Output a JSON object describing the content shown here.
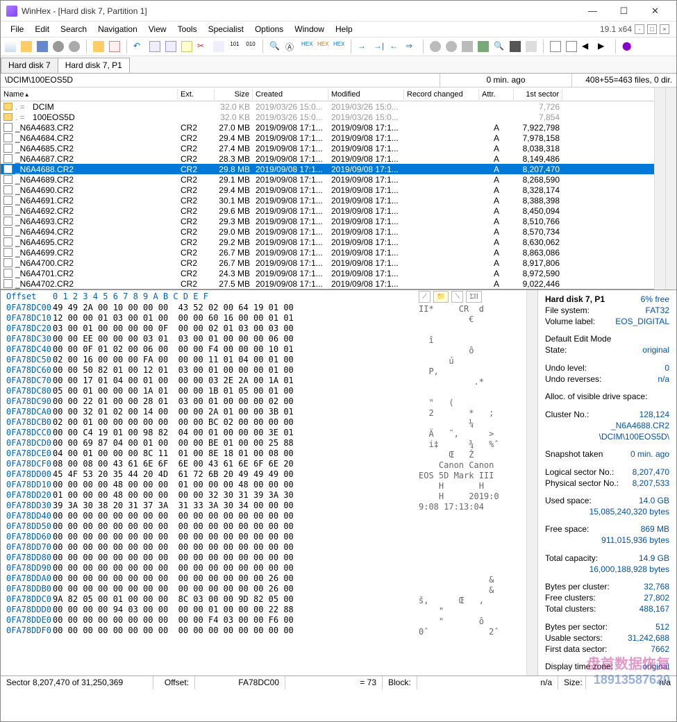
{
  "window": {
    "title": "WinHex - [Hard disk 7, Partition 1]",
    "version": "19.1 x64"
  },
  "menu": [
    "File",
    "Edit",
    "Search",
    "Navigation",
    "View",
    "Tools",
    "Specialist",
    "Options",
    "Window",
    "Help"
  ],
  "tabs": [
    {
      "label": "Hard disk 7",
      "active": false
    },
    {
      "label": "Hard disk 7, P1",
      "active": true
    }
  ],
  "pathbar": {
    "path": "\\DCIM\\100EOS5D",
    "age": "0 min. ago",
    "summary": "408+55=463 files, 0 dir."
  },
  "columns": [
    "Name",
    "Ext.",
    "Size",
    "Created",
    "Modified",
    "Record changed",
    "Attr.",
    "1st sector"
  ],
  "folders": [
    {
      "name": "DCIM",
      "prefix": ". =",
      "size": "32.0 KB",
      "created": "2019/03/26 15:0...",
      "modified": "2019/03/26 15:0...",
      "sector": "7,726"
    },
    {
      "name": "100EOS5D",
      "prefix": ". =",
      "size": "32.0 KB",
      "created": "2019/03/26 15:0...",
      "modified": "2019/03/26 15:0...",
      "sector": "7,854"
    }
  ],
  "files": [
    {
      "name": "_N6A4683.CR2",
      "ext": "CR2",
      "size": "27.0 MB",
      "created": "2019/09/08 17:1...",
      "modified": "2019/09/08 17:1...",
      "attr": "A",
      "sector": "7,922,798",
      "sel": false
    },
    {
      "name": "_N6A4684.CR2",
      "ext": "CR2",
      "size": "29.4 MB",
      "created": "2019/09/08 17:1...",
      "modified": "2019/09/08 17:1...",
      "attr": "A",
      "sector": "7,978,158",
      "sel": false
    },
    {
      "name": "_N6A4685.CR2",
      "ext": "CR2",
      "size": "27.4 MB",
      "created": "2019/09/08 17:1...",
      "modified": "2019/09/08 17:1...",
      "attr": "A",
      "sector": "8,038,318",
      "sel": false
    },
    {
      "name": "_N6A4687.CR2",
      "ext": "CR2",
      "size": "28.3 MB",
      "created": "2019/09/08 17:1...",
      "modified": "2019/09/08 17:1...",
      "attr": "A",
      "sector": "8,149,486",
      "sel": false
    },
    {
      "name": "_N6A4688.CR2",
      "ext": "CR2",
      "size": "29.8 MB",
      "created": "2019/09/08 17:1...",
      "modified": "2019/09/08 17:1...",
      "attr": "A",
      "sector": "8,207,470",
      "sel": true
    },
    {
      "name": "_N6A4689.CR2",
      "ext": "CR2",
      "size": "29.1 MB",
      "created": "2019/09/08 17:1...",
      "modified": "2019/09/08 17:1...",
      "attr": "A",
      "sector": "8,268,590",
      "sel": false
    },
    {
      "name": "_N6A4690.CR2",
      "ext": "CR2",
      "size": "29.4 MB",
      "created": "2019/09/08 17:1...",
      "modified": "2019/09/08 17:1...",
      "attr": "A",
      "sector": "8,328,174",
      "sel": false
    },
    {
      "name": "_N6A4691.CR2",
      "ext": "CR2",
      "size": "30.1 MB",
      "created": "2019/09/08 17:1...",
      "modified": "2019/09/08 17:1...",
      "attr": "A",
      "sector": "8,388,398",
      "sel": false
    },
    {
      "name": "_N6A4692.CR2",
      "ext": "CR2",
      "size": "29.6 MB",
      "created": "2019/09/08 17:1...",
      "modified": "2019/09/08 17:1...",
      "attr": "A",
      "sector": "8,450,094",
      "sel": false
    },
    {
      "name": "_N6A4693.CR2",
      "ext": "CR2",
      "size": "29.3 MB",
      "created": "2019/09/08 17:1...",
      "modified": "2019/09/08 17:1...",
      "attr": "A",
      "sector": "8,510,766",
      "sel": false
    },
    {
      "name": "_N6A4694.CR2",
      "ext": "CR2",
      "size": "29.0 MB",
      "created": "2019/09/08 17:1...",
      "modified": "2019/09/08 17:1...",
      "attr": "A",
      "sector": "8,570,734",
      "sel": false
    },
    {
      "name": "_N6A4695.CR2",
      "ext": "CR2",
      "size": "29.2 MB",
      "created": "2019/09/08 17:1...",
      "modified": "2019/09/08 17:1...",
      "attr": "A",
      "sector": "8,630,062",
      "sel": false
    },
    {
      "name": "_N6A4699.CR2",
      "ext": "CR2",
      "size": "26.7 MB",
      "created": "2019/09/08 17:1...",
      "modified": "2019/09/08 17:1...",
      "attr": "A",
      "sector": "8,863,086",
      "sel": false
    },
    {
      "name": "_N6A4700.CR2",
      "ext": "CR2",
      "size": "26.7 MB",
      "created": "2019/09/08 17:1...",
      "modified": "2019/09/08 17:1...",
      "attr": "A",
      "sector": "8,917,806",
      "sel": false
    },
    {
      "name": "_N6A4701.CR2",
      "ext": "CR2",
      "size": "24.3 MB",
      "created": "2019/09/08 17:1...",
      "modified": "2019/09/08 17:1...",
      "attr": "A",
      "sector": "8,972,590",
      "sel": false
    },
    {
      "name": "_N6A4702.CR2",
      "ext": "CR2",
      "size": "27.5 MB",
      "created": "2019/09/08 17:1...",
      "modified": "2019/09/08 17:1...",
      "attr": "A",
      "sector": "9,022,446",
      "sel": false
    }
  ],
  "hex": {
    "header": " 0  1  2  3  4  5  6  7   8  9  A  B  C  D  E  F",
    "header0": "Offset",
    "rows": [
      {
        "o": "0FA78DC00",
        "b": "49 49 2A 00 10 00 00 00  43 52 02 00 64 19 01 00",
        "a": "II*     CR  d   "
      },
      {
        "o": "0FA78DC10",
        "b": "12 00 00 01 03 00 01 00  00 00 60 16 00 00 01 01",
        "a": "          €     "
      },
      {
        "o": "0FA78DC20",
        "b": "03 00 01 00 00 00 00 0F  00 00 02 01 03 00 03 00",
        "a": "                "
      },
      {
        "o": "0FA78DC30",
        "b": "00 00 EE 00 00 00 03 01  03 00 01 00 00 00 06 00",
        "a": "  î             "
      },
      {
        "o": "0FA78DC40",
        "b": "00 00 0F 01 02 00 06 00  00 00 F4 00 00 00 10 01",
        "a": "          ô     "
      },
      {
        "o": "0FA78DC50",
        "b": "02 00 16 00 00 00 FA 00  00 00 11 01 04 00 01 00",
        "a": "      ú         "
      },
      {
        "o": "0FA78DC60",
        "b": "00 00 50 82 01 00 12 01  03 00 01 00 00 00 01 00",
        "a": "  P,            "
      },
      {
        "o": "0FA78DC70",
        "b": "00 00 17 01 04 00 01 00  00 00 03 2E 2A 00 1A 01",
        "a": "           .*   "
      },
      {
        "o": "0FA78DC80",
        "b": "05 00 01 00 00 00 1A 01  00 00 1B 01 05 00 01 00",
        "a": "                "
      },
      {
        "o": "0FA78DC90",
        "b": "00 00 22 01 00 00 28 01  03 00 01 00 00 00 02 00",
        "a": "  \"   (         "
      },
      {
        "o": "0FA78DCA0",
        "b": "00 00 32 01 02 00 14 00  00 00 2A 01 00 00 3B 01",
        "a": "  2       *   ; "
      },
      {
        "o": "0FA78DCB0",
        "b": "02 00 01 00 00 00 00 00  00 00 BC 02 00 00 00 00",
        "a": "          ¼     "
      },
      {
        "o": "0FA78DCC0",
        "b": "00 00 C4 19 01 00 98 82  04 00 01 00 00 00 3E 01",
        "a": "  Ä   ˜,      > "
      },
      {
        "o": "0FA78DCD0",
        "b": "00 00 69 87 04 00 01 00  00 00 BE 01 00 00 25 88",
        "a": "  i‡      ¾   %ˆ"
      },
      {
        "o": "0FA78DCE0",
        "b": "04 00 01 00 00 00 8C 11  01 00 8E 18 01 00 08 00",
        "a": "      Œ   Ž     "
      },
      {
        "o": "0FA78DCF0",
        "b": "08 00 08 00 43 61 6E 6F  6E 00 43 61 6E 6F 6E 20",
        "a": "    Canon Canon "
      },
      {
        "o": "0FA78DD00",
        "b": "45 4F 53 20 35 44 20 4D  61 72 6B 20 49 49 49 00",
        "a": "EOS 5D Mark III "
      },
      {
        "o": "0FA78DD10",
        "b": "00 00 00 00 48 00 00 00  01 00 00 00 48 00 00 00",
        "a": "    H       H   "
      },
      {
        "o": "0FA78DD20",
        "b": "01 00 00 00 48 00 00 00  00 00 32 30 31 39 3A 30",
        "a": "    H     2019:0"
      },
      {
        "o": "0FA78DD30",
        "b": "39 3A 30 38 20 31 37 3A  31 33 3A 30 34 00 00 00",
        "a": "9:08 17:13:04   "
      },
      {
        "o": "0FA78DD40",
        "b": "00 00 00 00 00 00 00 00  00 00 00 00 00 00 00 00",
        "a": "                "
      },
      {
        "o": "0FA78DD50",
        "b": "00 00 00 00 00 00 00 00  00 00 00 00 00 00 00 00",
        "a": "                "
      },
      {
        "o": "0FA78DD60",
        "b": "00 00 00 00 00 00 00 00  00 00 00 00 00 00 00 00",
        "a": "                "
      },
      {
        "o": "0FA78DD70",
        "b": "00 00 00 00 00 00 00 00  00 00 00 00 00 00 00 00",
        "a": "                "
      },
      {
        "o": "0FA78DD80",
        "b": "00 00 00 00 00 00 00 00  00 00 00 00 00 00 00 00",
        "a": "                "
      },
      {
        "o": "0FA78DD90",
        "b": "00 00 00 00 00 00 00 00  00 00 00 00 00 00 00 00",
        "a": "                "
      },
      {
        "o": "0FA78DDA0",
        "b": "00 00 00 00 00 00 00 00  00 00 00 00 00 00 26 00",
        "a": "              & "
      },
      {
        "o": "0FA78DDB0",
        "b": "00 00 00 00 00 00 00 00  00 00 00 00 00 00 26 00",
        "a": "              & "
      },
      {
        "o": "0FA78DDC0",
        "b": "9A 82 05 00 01 00 00 00  8C 03 00 00 9D 82 05 00",
        "a": "š,      Œ   ,   "
      },
      {
        "o": "0FA78DDD0",
        "b": "00 00 00 00 94 03 00 00  00 00 01 00 00 00 22 88",
        "a": "    \"           "
      },
      {
        "o": "0FA78DDE0",
        "b": "00 00 00 00 00 00 00 00  00 00 F4 03 00 00 F6 00",
        "a": "    \"       ô   "
      },
      {
        "o": "0FA78DDF0",
        "b": "00 00 00 00 00 00 00 00  00 00 00 00 00 00 00 00",
        "a": "0ˆ            2ˆ"
      }
    ]
  },
  "info": {
    "title": "Hard disk 7, P1",
    "free": "6% free",
    "fs_k": "File system:",
    "fs_v": "FAT32",
    "vl_k": "Volume label:",
    "vl_v": "EOS_DIGITAL",
    "mode_k": "Default Edit Mode",
    "state_k": "State:",
    "state_v": "original",
    "ul_k": "Undo level:",
    "ul_v": "0",
    "ur_k": "Undo reverses:",
    "ur_v": "n/a",
    "alloc": "Alloc. of visible drive space:",
    "cn_k": "Cluster No.:",
    "cn_v": "128,124",
    "fname": "_N6A4688.CR2",
    "fpath": "\\DCIM\\100EOS5D\\",
    "snap_k": "Snapshot taken",
    "snap_v": "0 min. ago",
    "ls_k": "Logical sector No.:",
    "ls_v": "8,207,470",
    "ps_k": "Physical sector No.:",
    "ps_v": "8,207,533",
    "us_k": "Used space:",
    "us_v": "14.0 GB",
    "us_b": "15,085,240,320 bytes",
    "fsp_k": "Free space:",
    "fsp_v": "869 MB",
    "fsp_b": "911,015,936 bytes",
    "tc_k": "Total capacity:",
    "tc_v": "14.9 GB",
    "tc_b": "16,000,188,928 bytes",
    "bpc_k": "Bytes per cluster:",
    "bpc_v": "32,768",
    "fc_k": "Free clusters:",
    "fc_v": "27,802",
    "tcl_k": "Total clusters:",
    "tcl_v": "488,167",
    "bps_k": "Bytes per sector:",
    "bps_v": "512",
    "usec_k": "Usable sectors:",
    "usec_v": "31,242,688",
    "fds_k": "First data sector:",
    "fds_v": "7662",
    "dtz_k": "Display time zone:",
    "dtz_v": "original"
  },
  "statusbar": {
    "sector": "Sector 8,207,470 of 31,250,369",
    "offset_k": "Offset:",
    "offset_v": "FA78DC00",
    "eq": "= 73",
    "block_k": "Block:",
    "block_v": "n/a",
    "size_k": "Size:",
    "size_v": "n/a"
  },
  "watermark": {
    "l1": "盘首数据恢复",
    "l2": "18913587620"
  }
}
